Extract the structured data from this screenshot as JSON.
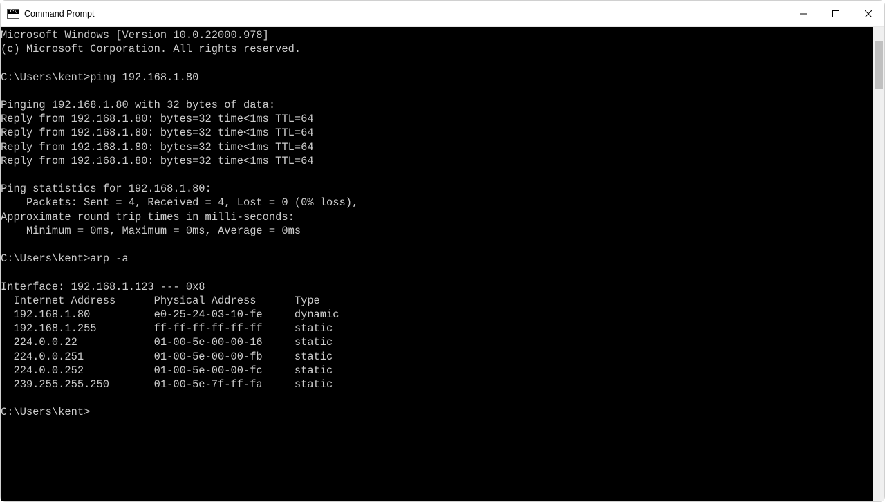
{
  "window": {
    "title": "Command Prompt"
  },
  "terminal": {
    "lines": {
      "ver1": "Microsoft Windows [Version 10.0.22000.978]",
      "ver2": "(c) Microsoft Corporation. All rights reserved.",
      "blank": "",
      "prompt1": "C:\\Users\\kent>ping 192.168.1.80",
      "ping_hdr": "Pinging 192.168.1.80 with 32 bytes of data:",
      "reply1": "Reply from 192.168.1.80: bytes=32 time<1ms TTL=64",
      "reply2": "Reply from 192.168.1.80: bytes=32 time<1ms TTL=64",
      "reply3": "Reply from 192.168.1.80: bytes=32 time<1ms TTL=64",
      "reply4": "Reply from 192.168.1.80: bytes=32 time<1ms TTL=64",
      "stats_hdr": "Ping statistics for 192.168.1.80:",
      "stats_pkts": "    Packets: Sent = 4, Received = 4, Lost = 0 (0% loss),",
      "rtt_hdr": "Approximate round trip times in milli-seconds:",
      "rtt_vals": "    Minimum = 0ms, Maximum = 0ms, Average = 0ms",
      "prompt2": "C:\\Users\\kent>arp -a",
      "iface": "Interface: 192.168.1.123 --- 0x8",
      "arp_hdr": "  Internet Address      Physical Address      Type",
      "arp1": "  192.168.1.80          e0-25-24-03-10-fe     dynamic",
      "arp2": "  192.168.1.255         ff-ff-ff-ff-ff-ff     static",
      "arp3": "  224.0.0.22            01-00-5e-00-00-16     static",
      "arp4": "  224.0.0.251           01-00-5e-00-00-fb     static",
      "arp5": "  224.0.0.252           01-00-5e-00-00-fc     static",
      "arp6": "  239.255.255.250       01-00-5e-7f-ff-fa     static",
      "prompt3": "C:\\Users\\kent>"
    }
  }
}
